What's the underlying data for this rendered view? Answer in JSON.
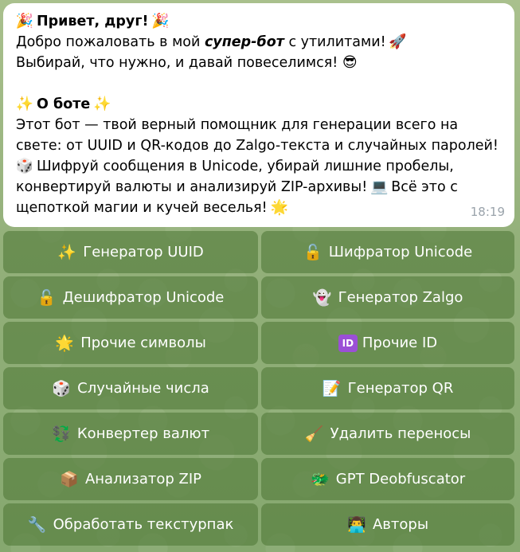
{
  "message": {
    "greeting": "Привет, друг!",
    "welcome_before": "Добро пожаловать в мой",
    "welcome_em": "супер-бот",
    "welcome_after": "с утилитами!",
    "line3": "Выбирай, что нужно, и давай повеселимся!",
    "about_title": "О боте",
    "about_l1": "Этот бот — твой верный помощник для генерации всего на",
    "about_l2": "свете: от UUID и QR-кодов до Zalgo-текста и случайных паролей!",
    "about_l3": "Шифруй сообщения в Unicode, убирай лишние пробелы,",
    "about_l4a": "конвертируй валюты и анализируй ZIP-архивы!",
    "about_l4b": "Всё это с",
    "about_l5": "щепоткой магии и кучей веселья!",
    "time": "18:19",
    "icons": {
      "party": "🎉",
      "rocket": "🚀",
      "sunglasses": "😎",
      "sparkles": "✨",
      "dice": "🎲",
      "laptop": "💻",
      "star": "🌟"
    }
  },
  "keyboard": {
    "buttons": [
      {
        "icon": "✨",
        "label": "Генератор UUID"
      },
      {
        "icon": "🔓",
        "label": "Шифратор Unicode"
      },
      {
        "icon": "🔓",
        "label": "Дешифратор Unicode"
      },
      {
        "icon": "👻",
        "label": "Генератор Zalgo"
      },
      {
        "icon": "🌟",
        "label": "Прочие символы"
      },
      {
        "icon": "ID",
        "label": "Прочие ID"
      },
      {
        "icon": "🎲",
        "label": "Случайные числа"
      },
      {
        "icon": "📝",
        "label": "Генератор QR"
      },
      {
        "icon": "💱",
        "label": "Конвертер валют"
      },
      {
        "icon": "🧹",
        "label": "Удалить переносы"
      },
      {
        "icon": "📦",
        "label": "Анализатор ZIP"
      },
      {
        "icon": "🐲",
        "label": "GPT Deobfuscator"
      },
      {
        "icon": "🔧",
        "label": "Обработать текстурпак"
      },
      {
        "icon": "👨‍💻",
        "label": "Авторы"
      }
    ]
  }
}
